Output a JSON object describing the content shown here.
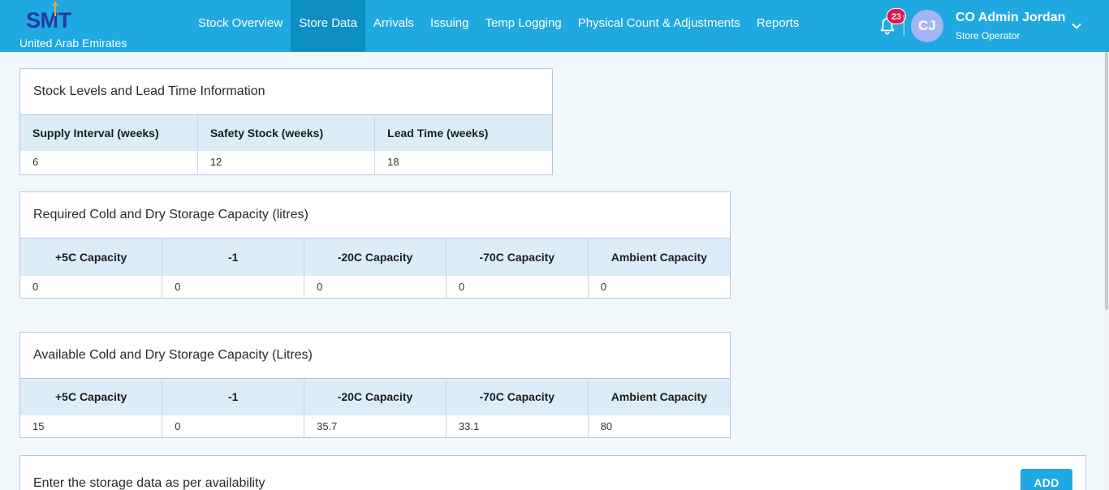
{
  "app": {
    "logo_text": "SMT",
    "country": "United Arab Emirates"
  },
  "nav": {
    "items": [
      "Stock Overview",
      "Store Data",
      "Arrivals",
      "Issuing",
      "Temp Logging",
      "Physical Count & Adjustments",
      "Reports"
    ],
    "active": "Store Data"
  },
  "header": {
    "notifications_count": "23",
    "avatar_initials": "CJ",
    "user_name": "CO Admin Jordan",
    "user_role": "Store Operator",
    "icons": [
      "bell-icon",
      "chevron-down-icon"
    ]
  },
  "stock_levels": {
    "title": "Stock Levels and Lead Time Information",
    "headers": [
      "Supply Interval (weeks)",
      "Safety Stock (weeks)",
      "Lead Time (weeks)"
    ],
    "values": [
      "6",
      "12",
      "18"
    ]
  },
  "required_capacity": {
    "title": "Required Cold and Dry Storage Capacity (litres)",
    "headers": [
      "+5C Capacity",
      "-1",
      "-20C Capacity",
      "-70C Capacity",
      "Ambient Capacity"
    ],
    "values": [
      "0",
      "0",
      "0",
      "0",
      "0"
    ]
  },
  "available_capacity": {
    "title": "Available Cold and Dry Storage Capacity (Litres)",
    "headers": [
      "+5C Capacity",
      "-1",
      "-20C Capacity",
      "-70C Capacity",
      "Ambient Capacity"
    ],
    "values": [
      "15",
      "0",
      "35.7",
      "33.1",
      "80"
    ]
  },
  "storage_entry": {
    "title": "Enter the storage data as per availability",
    "add_label": "ADD"
  },
  "colors": {
    "topbar": "#20a8e0",
    "nav_active": "#0d8fc4",
    "logo": "#243a9c",
    "badge": "#e8124c",
    "avatar": "#a5b4f5",
    "table_header": "#dcedf8"
  }
}
